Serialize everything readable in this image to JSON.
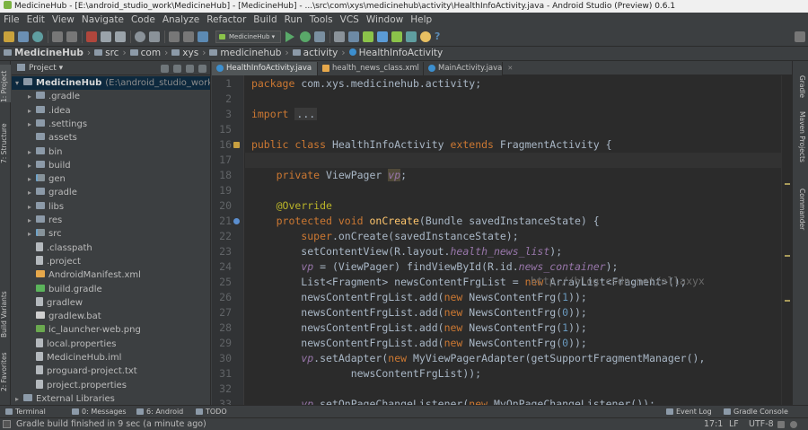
{
  "window": {
    "title": "MedicineHub - [E:\\android_studio_work\\MedicineHub] - [MedicineHub] - ...\\src\\com\\xys\\medicinehub\\activity\\HealthInfoActivity.java - Android Studio (Preview) 0.6.1"
  },
  "menu": [
    "File",
    "Edit",
    "View",
    "Navigate",
    "Code",
    "Analyze",
    "Refactor",
    "Build",
    "Run",
    "Tools",
    "VCS",
    "Window",
    "Help"
  ],
  "toolbar": {
    "module": "MedicineHub",
    "help": "?"
  },
  "breadcrumbs": [
    "MedicineHub",
    "src",
    "com",
    "xys",
    "medicinehub",
    "activity",
    "HealthInfoActivity"
  ],
  "left_tool_tabs": [
    "1: Project",
    "7: Structure",
    "Build Variants",
    "2: Favorites"
  ],
  "right_tool_tabs": [
    "Gradle",
    "Maven Projects",
    "Commander"
  ],
  "project": {
    "header": "Project",
    "root": "MedicineHub",
    "root_path": "(E:\\android_studio_work\\M",
    "items": [
      {
        "label": ".gradle",
        "type": "folder",
        "arrow": true
      },
      {
        "label": ".idea",
        "type": "folder",
        "arrow": true
      },
      {
        "label": ".settings",
        "type": "folder",
        "arrow": true
      },
      {
        "label": "assets",
        "type": "folder",
        "arrow": false
      },
      {
        "label": "bin",
        "type": "folder",
        "arrow": true
      },
      {
        "label": "build",
        "type": "folder",
        "arrow": true
      },
      {
        "label": "gen",
        "type": "folder-src",
        "arrow": true
      },
      {
        "label": "gradle",
        "type": "folder",
        "arrow": true
      },
      {
        "label": "libs",
        "type": "folder",
        "arrow": true
      },
      {
        "label": "res",
        "type": "folder",
        "arrow": true
      },
      {
        "label": "src",
        "type": "folder-src",
        "arrow": true
      },
      {
        "label": ".classpath",
        "type": "file",
        "arrow": false
      },
      {
        "label": ".project",
        "type": "file",
        "arrow": false
      },
      {
        "label": "AndroidManifest.xml",
        "type": "file-xml",
        "arrow": false
      },
      {
        "label": "build.gradle",
        "type": "file-gradle",
        "arrow": false
      },
      {
        "label": "gradlew",
        "type": "file",
        "arrow": false
      },
      {
        "label": "gradlew.bat",
        "type": "file-bat",
        "arrow": false
      },
      {
        "label": "ic_launcher-web.png",
        "type": "file-img",
        "arrow": false
      },
      {
        "label": "local.properties",
        "type": "file",
        "arrow": false
      },
      {
        "label": "MedicineHub.iml",
        "type": "file",
        "arrow": false
      },
      {
        "label": "proguard-project.txt",
        "type": "file",
        "arrow": false
      },
      {
        "label": "project.properties",
        "type": "file",
        "arrow": false
      }
    ],
    "external": "External Libraries"
  },
  "editor": {
    "tabs": [
      {
        "label": "HealthInfoActivity.java",
        "active": true,
        "kind": "java"
      },
      {
        "label": "health_news_class.xml",
        "active": false,
        "kind": "xml"
      },
      {
        "label": "MainActivity.java",
        "active": false,
        "kind": "java"
      }
    ],
    "line_numbers": [
      "1",
      "2",
      "3",
      "15",
      "16",
      "17",
      "18",
      "19",
      "20",
      "21",
      "22",
      "23",
      "24",
      "25",
      "26",
      "27",
      "28",
      "29",
      "30",
      "31",
      "32",
      "33"
    ],
    "watermark": "http://blog.csdn.net/allaxyx"
  },
  "bottom_tabs": [
    "Terminal",
    "0: Messages",
    "6: Android",
    "TODO",
    "Event Log",
    "Gradle Console"
  ],
  "status": {
    "message": "Gradle build finished in 9 sec (a minute ago)",
    "position": "17:1",
    "line_sep": "LF",
    "encoding": "UTF-8"
  }
}
